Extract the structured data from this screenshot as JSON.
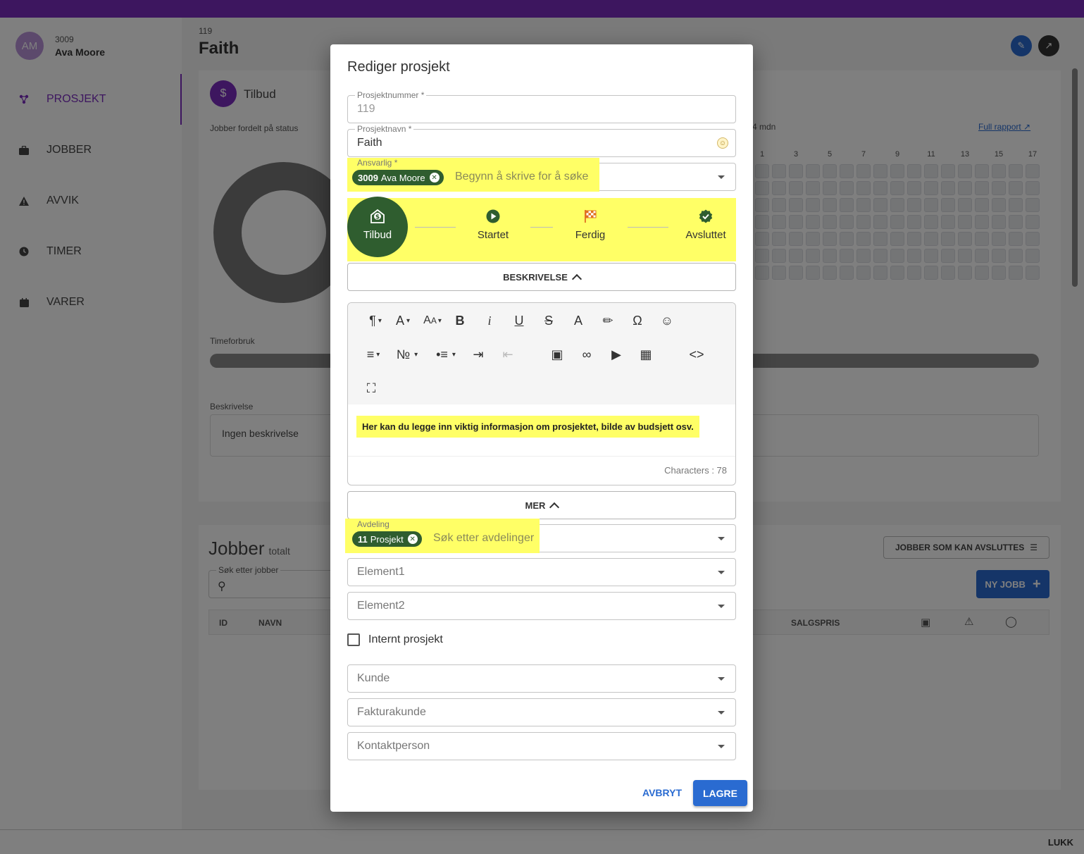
{
  "user": {
    "initials": "AM",
    "id": "3009",
    "name": "Ava Moore"
  },
  "nav": {
    "items": [
      {
        "label": "PROSJEKT",
        "icon": "project-icon",
        "active": true
      },
      {
        "label": "JOBBER",
        "icon": "briefcase-icon",
        "active": false
      },
      {
        "label": "AVVIK",
        "icon": "warning-icon",
        "active": false
      },
      {
        "label": "TIMER",
        "icon": "clock-icon",
        "active": false
      },
      {
        "label": "VARER",
        "icon": "box-icon",
        "active": false
      }
    ]
  },
  "project": {
    "number": "119",
    "name": "Faith"
  },
  "card": {
    "status": "Tilbud",
    "jobs_by_status_label": "Jobber fordelt på status",
    "time_usage_label": "Timeforbruk",
    "description_label": "Beskrivelse",
    "description_value": "Ingen beskrivelse",
    "period_label": "4 mdn",
    "full_report": "Full rapport",
    "heatmap_columns": [
      "1",
      "3",
      "5",
      "7",
      "9",
      "11",
      "13",
      "15",
      "17"
    ]
  },
  "jobs": {
    "title": "Jobber",
    "subtitle": "totalt",
    "search_label": "Søk etter jobber",
    "closable_button": "JOBBER SOM KAN AVSLUTTES",
    "new_button": "NY JOBB",
    "columns": {
      "id": "ID",
      "name": "NAVN",
      "price": "SALGSPRIS"
    }
  },
  "footer": {
    "close": "LUKK"
  },
  "modal": {
    "title": "Rediger prosjekt",
    "project_number": {
      "label": "Prosjektnummer *",
      "value": "119"
    },
    "project_name": {
      "label": "Prosjektnavn *",
      "value": "Faith"
    },
    "responsible": {
      "label": "Ansvarlig *",
      "chip_id": "3009",
      "chip_name": "Ava Moore",
      "placeholder": "Begynn å skrive for å søke"
    },
    "steps": [
      {
        "label": "Tilbud",
        "active": true
      },
      {
        "label": "Startet",
        "active": false
      },
      {
        "label": "Ferdig",
        "active": false
      },
      {
        "label": "Avsluttet",
        "active": false
      }
    ],
    "description_section": "BESKRIVELSE",
    "editor_text": "Her kan du legge inn viktig informasjon om prosjektet, bilde av budsjett osv.",
    "char_count": "Characters : 78",
    "more_section": "MER",
    "department": {
      "label": "Avdeling",
      "chip_id": "11",
      "chip_name": "Prosjekt",
      "placeholder": "Søk etter avdelinger"
    },
    "element1": "Element1",
    "element2": "Element2",
    "internal_label": "Internt prosjekt",
    "customer": "Kunde",
    "invoice_customer": "Fakturakunde",
    "contact_person": "Kontaktperson",
    "cancel": "AVBRYT",
    "save": "LAGRE"
  },
  "colors": {
    "brand_purple": "#7b2cbf",
    "primary_blue": "#2a6bd1",
    "chip_green": "#2f5d2f",
    "highlight_yellow": "#ffff66"
  }
}
